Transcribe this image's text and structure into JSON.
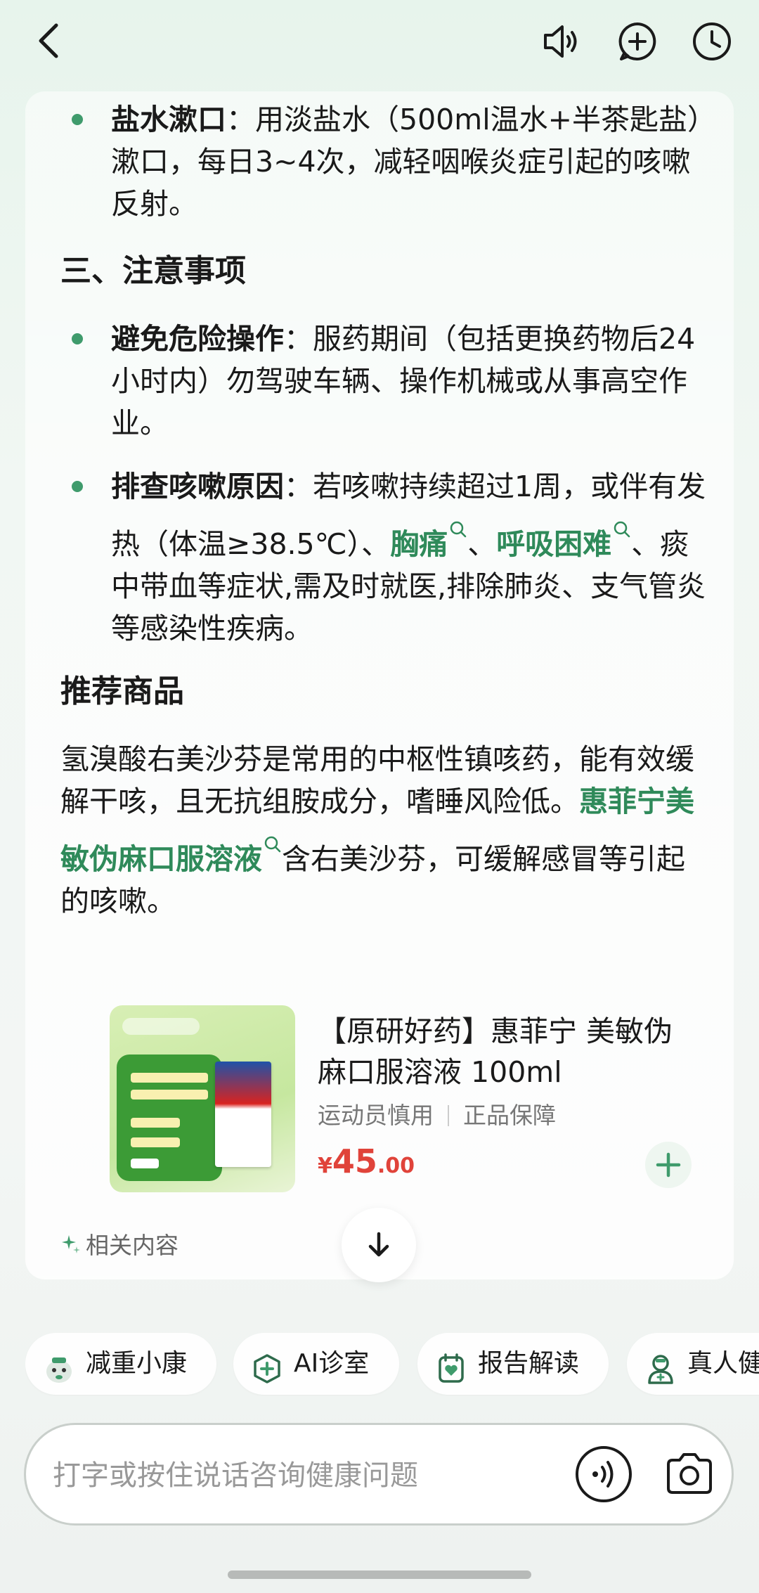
{
  "bullets_top": [
    {
      "title": "盐水漱口",
      "colon": "：",
      "text": "用淡盐水（500ml温水+半茶匙盐）漱口，每日3~4次，减轻咽喉炎症引起的咳嗽反射。"
    }
  ],
  "section_notice": "三、注意事项",
  "notice_bullets": {
    "b1_title": "避免危险操作",
    "b1_text": "：服药期间（包括更换药物后24小时内）勿驾驶车辆、操作机械或从事高空作业。",
    "b2_title": "排查咳嗽原因",
    "b2_text_a": "：若咳嗽持续超过1周，或伴有发热（体温≥38.5℃）、",
    "b2_link1": "胸痛",
    "b2_sep": "、",
    "b2_link2": "呼吸困难",
    "b2_text_b": "、痰中带血等症状,需及时就医,排除肺炎、支气管炎等感染性疾病。"
  },
  "section_recommend": "推荐商品",
  "recommend_para": {
    "text_a": "氢溴酸右美沙芬是常用的中枢性镇咳药，能有效缓解干咳，且无抗组胺成分，嗜睡风险低。",
    "link": "惠菲宁美敏伪麻口服溶液",
    "text_b": "含右美沙芬，可缓解感冒等引起的咳嗽。"
  },
  "product": {
    "name": "【原研好药】惠菲宁 美敏伪麻口服溶液 100ml",
    "tag1": "运动员慎用",
    "tag2": "正品保障",
    "price_currency": "¥",
    "price_int": "45",
    "price_dec": ".00"
  },
  "related_label": "相关内容",
  "chips": [
    {
      "label": "减重小康",
      "icon": "mascot-icon"
    },
    {
      "label": "AI诊室",
      "icon": "medical-cross-icon"
    },
    {
      "label": "报告解读",
      "icon": "report-heart-icon"
    },
    {
      "label": "真人健康咨询",
      "icon": "doctor-icon"
    }
  ],
  "input": {
    "placeholder": "打字或按住说话咨询健康问题"
  },
  "colors": {
    "accent": "#2f8a5a",
    "price": "#e0433a",
    "dot": "#3f9b6c"
  }
}
